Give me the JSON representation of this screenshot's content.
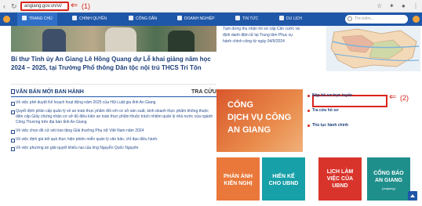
{
  "browser": {
    "url": "angiang.gov.vn/vi/",
    "annotation_1": "(1)"
  },
  "nav": {
    "items": [
      "TRANG CHỦ",
      "CHÍNH QUYỀN",
      "CÔNG DÂN",
      "DOANH NGHIỆP",
      "TIN TỨC",
      "DU LỊCH"
    ],
    "search_placeholder": "Tìm kiếm..."
  },
  "news_right": [
    "Tạm dừng thu nhận hồ sơ cấp Căn cước và",
    "định danh điện tử tại Trung tâm Phục vụ",
    "hành chính công từ ngày 04/9/2024"
  ],
  "headline": "Bí thư Tỉnh ủy An Giang Lê Hồng Quang dự Lễ khai giảng năm học 2024 – 2025, tại Trường Phổ thông Dân tộc nội trú THCS Tri Tôn",
  "documents": {
    "title": "VĂN BẢN MỚI BAN HÀNH",
    "lookup": "TRA CỨU",
    "items": [
      "Về việc phê duyệt Kế hoạch hoạt động năm 2025 của Hội Luật gia tỉnh An Giang",
      "Quyết định phân cấp quản lý về an toàn thực phẩm đối với cơ sở sản xuất, kinh doanh thực phẩm không thuộc diện cấp Giấy chứng nhận cơ sở đủ điều kiện an toàn thực phẩm thuộc trách nhiệm quản lý nhà nước của ngành Công Thương trên địa bàn tỉnh An Giang",
      "Về việc chọn đề cử xét trao tặng Giải thưởng Phụ nữ Việt Nam năm 2024",
      "Về việc định giá kết quả thực hiện phiên miễn quản lý văn bản, chỉ đạo điều hành.",
      "Về việc phương án giải quyết khiếu nại của ông Nguyễn Quốc Nguyên"
    ]
  },
  "public_service": {
    "lines": [
      "CỔNG",
      "DỊCH VỤ CÔNG",
      "AN GIANG"
    ],
    "links": [
      "Nộp hồ sơ trực tuyến",
      "Tra cứu hồ sơ",
      "Thủ tục hành chính"
    ],
    "annotation_2": "(2)"
  },
  "tiles": [
    {
      "lines": [
        "PHẢN ÁNH",
        "KIẾN NGHỊ"
      ],
      "sub": ""
    },
    {
      "lines": [
        "HIẾN KẾ",
        "CHO UBND"
      ],
      "sub": ""
    },
    {
      "lines": [
        "LỊCH LÀM",
        "VIỆC CỦA",
        "UBND"
      ],
      "sub": ""
    },
    {
      "lines": [
        "CỔNG BÁO",
        "AN GIANG"
      ],
      "sub": "(angiang)"
    }
  ],
  "colors": {
    "nav_blue": "#1f57a8",
    "annotation_red": "#d9241c",
    "service_orange": "#d9572c"
  }
}
